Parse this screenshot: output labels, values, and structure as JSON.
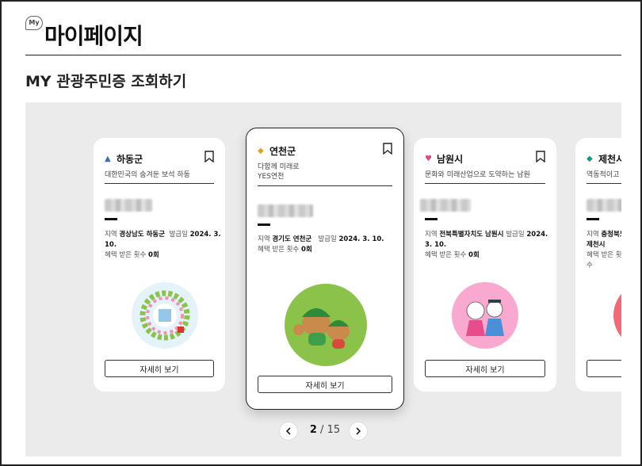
{
  "header": {
    "badge": "My",
    "title": "마이페이지"
  },
  "section": {
    "title": "MY 관광주민증 조회하기"
  },
  "labels": {
    "region": "지역",
    "issued": "발급일",
    "benefits": "혜택 받은 횟수",
    "detail": "자세히 보기"
  },
  "cards": [
    {
      "name": "하동군",
      "slogan": "대한민국의 숨겨둔 보석 하동",
      "region": "경상남도 하동군",
      "issued": "2024. 3. 10.",
      "benefits": "0회",
      "color": "#3a6fb5"
    },
    {
      "name": "연천군",
      "slogan": "다함께 미래로\nYES연천",
      "region": "경기도 연천군",
      "issued": "2024. 3. 10.",
      "benefits": "0회",
      "color": "#e0a21a"
    },
    {
      "name": "남원시",
      "slogan": "문화와 미래산업으로 도약하는 남원",
      "region": "전북특별자치도 남원시",
      "issued": "2024. 3. 10.",
      "benefits": "0회",
      "color": "#e0457b"
    },
    {
      "name": "제천시",
      "slogan": "역동적이고 ..",
      "region": "충청북도 제천시",
      "issued": "",
      "benefits": "",
      "color": "#1e8f82"
    }
  ],
  "pager": {
    "current": "2",
    "separator": "/",
    "total": "15"
  },
  "icons": {
    "prev": "chevron-left-icon",
    "next": "chevron-right-icon",
    "bookmark": "bookmark-icon"
  }
}
